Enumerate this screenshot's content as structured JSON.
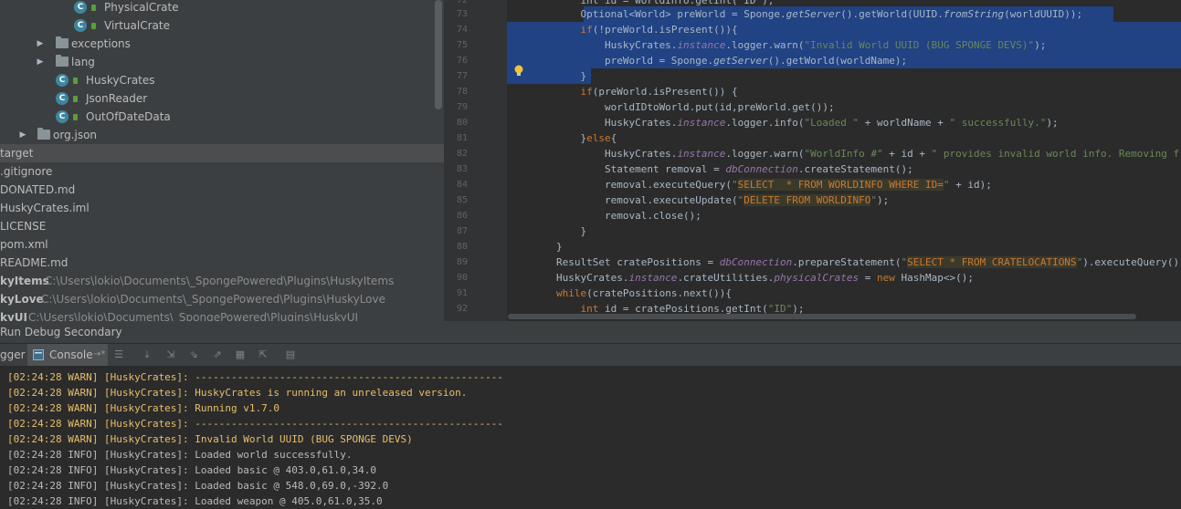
{
  "tree": {
    "items": [
      {
        "label": "PhysicalCrate"
      },
      {
        "label": "VirtualCrate"
      },
      {
        "label": "exceptions"
      },
      {
        "label": "lang"
      },
      {
        "label": "HuskyCrates"
      },
      {
        "label": "JsonReader"
      },
      {
        "label": "OutOfDateData"
      },
      {
        "label": "org.json"
      },
      {
        "label": "target"
      },
      {
        "label": ".gitignore"
      },
      {
        "label": "DONATED.md"
      },
      {
        "label": "HuskyCrates.iml"
      },
      {
        "label": "LICENSE"
      },
      {
        "label": "pom.xml"
      },
      {
        "label": "README.md"
      }
    ],
    "modules": [
      {
        "name": "kyItems",
        "path": "C:\\Users\\lokio\\Documents\\_SpongePowered\\Plugins\\HuskyItems"
      },
      {
        "name": "kyLove",
        "path": "C:\\Users\\lokio\\Documents\\_SpongePowered\\Plugins\\HuskyLove"
      },
      {
        "name": "kyUI",
        "path": "C:\\Users\\lokio\\Documents\\_SpongePowered\\Plugins\\HuskyUI"
      }
    ]
  },
  "editor": {
    "line_numbers": [
      "72",
      "73",
      "74",
      "75",
      "76",
      "77",
      "78",
      "79",
      "80",
      "81",
      "82",
      "83",
      "84",
      "85",
      "86",
      "87",
      "88",
      "89",
      "90",
      "91",
      "92"
    ],
    "lines": {
      "l72": "            int id = worldInfo.getInt(\"ID\");",
      "l73_a": "            Optional<World> preWorld = Sponge.",
      "l73_b": "getServer",
      "l73_c": "().getWorld(UUID.",
      "l73_d": "fromString",
      "l73_e": "(worldUUID));",
      "l74_a": "            ",
      "l74_b": "if",
      "l74_c": "(!preWorld.isPresent()){",
      "l75_a": "                HuskyCrates.",
      "l75_b": "instance",
      "l75_c": ".logger.warn(",
      "l75_d": "\"Invalid World UUID (BUG SPONGE DEVS)\"",
      "l75_e": ");",
      "l76_a": "                preWorld = Sponge.",
      "l76_b": "getServer",
      "l76_c": "().getWorld(worldName);",
      "l77": "            }",
      "l78_a": "            ",
      "l78_b": "if",
      "l78_c": "(preWorld.isPresent()) {",
      "l79": "                worldIDtoWorld.put(id,preWorld.get());",
      "l80_a": "                HuskyCrates.",
      "l80_b": "instance",
      "l80_c": ".logger.info(",
      "l80_d": "\"Loaded \"",
      "l80_e": " + worldName + ",
      "l80_f": "\" successfully.\"",
      "l80_g": ");",
      "l81_a": "            }",
      "l81_b": "else",
      "l81_c": "{",
      "l82_a": "                HuskyCrates.",
      "l82_b": "instance",
      "l82_c": ".logger.warn(",
      "l82_d": "\"WorldInfo #\"",
      "l82_e": " + id + ",
      "l82_f": "\" provides invalid world info. Removing from database.\"",
      "l83_a": "                Statement removal = ",
      "l83_b": "dbConnection",
      "l83_c": ".createStatement();",
      "l84_a": "                removal.executeQuery(",
      "l84_b": "\"",
      "l84_c": "SELECT  * FROM WORLDINFO WHERE ID=",
      "l84_d": "\"",
      "l84_e": " + id);",
      "l85_a": "                removal.executeUpdate(",
      "l85_b": "\"",
      "l85_c": "DELETE FROM WORLDINFO",
      "l85_d": "\"",
      "l85_e": ");",
      "l86": "                removal.close();",
      "l87": "            }",
      "l88": "        }",
      "l89_a": "        ResultSet cratePositions = ",
      "l89_b": "dbConnection",
      "l89_c": ".prepareStatement(",
      "l89_d": "\"",
      "l89_e": "SELECT * FROM CRATELOCATIONS",
      "l89_f": "\"",
      "l89_g": ").executeQuery();",
      "l90_a": "        HuskyCrates.",
      "l90_b": "instance",
      "l90_c": ".crateUtilities.",
      "l90_d": "physicalCrates",
      "l90_e": " = ",
      "l90_f": "new",
      "l90_g": " HashMap<>();",
      "l91_a": "        ",
      "l91_b": "while",
      "l91_c": "(cratePositions.next()){",
      "l92_a": "            ",
      "l92_b": "int",
      "l92_c": " id = cratePositions.getInt(",
      "l92_d": "\"ID\"",
      "l92_e": ");"
    }
  },
  "panel": {
    "title": "Run Debug Secondary",
    "tab_logger": "gger",
    "tab_console": "Console",
    "console_arrow": "→*"
  },
  "console": {
    "lines": [
      {
        "level": "warn",
        "text": "[02:24:28 WARN] [HuskyCrates]: ---------------------------------------------------"
      },
      {
        "level": "warn",
        "text": "[02:24:28 WARN] [HuskyCrates]: HuskyCrates is running an unreleased version."
      },
      {
        "level": "warn",
        "text": "[02:24:28 WARN] [HuskyCrates]: Running v1.7.0"
      },
      {
        "level": "warn",
        "text": "[02:24:28 WARN] [HuskyCrates]: ---------------------------------------------------"
      },
      {
        "level": "warn",
        "text": "[02:24:28 WARN] [HuskyCrates]: Invalid World UUID (BUG SPONGE DEVS)"
      },
      {
        "level": "info",
        "text": "[02:24:28 INFO] [HuskyCrates]: Loaded world successfully."
      },
      {
        "level": "info",
        "text": "[02:24:28 INFO] [HuskyCrates]: Loaded basic @ 403.0,61.0,34.0"
      },
      {
        "level": "info",
        "text": "[02:24:28 INFO] [HuskyCrates]: Loaded basic @ 548.0,69.0,-392.0"
      },
      {
        "level": "info",
        "text": "[02:24:28 INFO] [HuskyCrates]: Loaded weapon @ 405.0,61.0,35.0"
      }
    ]
  },
  "colors": {
    "selection": "#214283",
    "keyword": "#cc7832",
    "string": "#6a8759",
    "warn": "#e8bf6a",
    "info": "#bbbbbb"
  }
}
